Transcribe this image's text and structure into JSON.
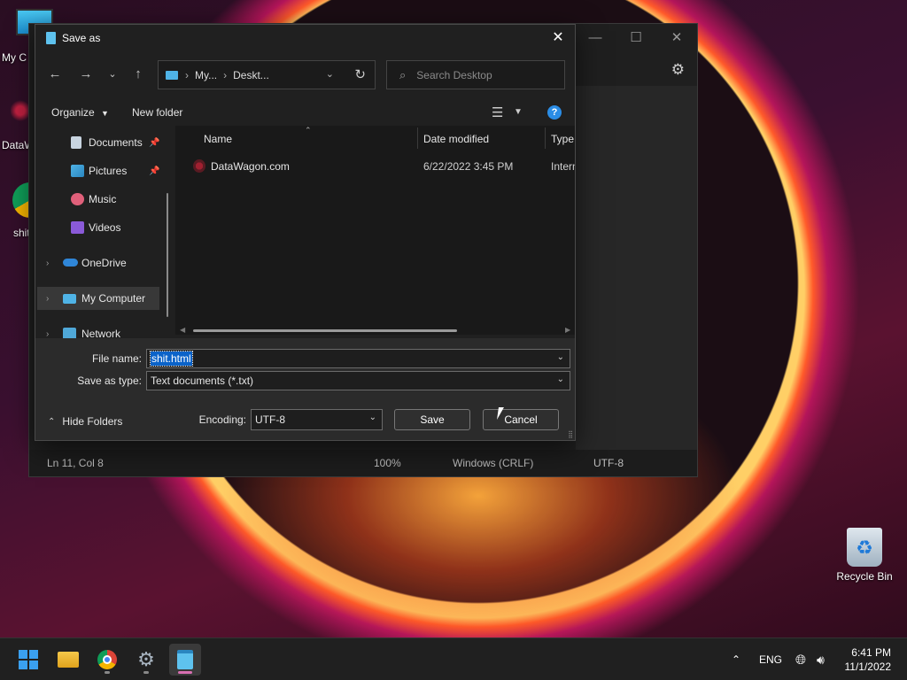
{
  "desktop": {
    "icons": [
      "My C",
      "DataW",
      "shit"
    ],
    "recycle_bin": "Recycle Bin"
  },
  "notepad": {
    "status": {
      "position": "Ln 11, Col 8",
      "zoom": "100%",
      "line_ending": "Windows (CRLF)",
      "encoding": "UTF-8"
    }
  },
  "dialog": {
    "title": "Save as",
    "address": {
      "segment1": "My...",
      "segment2": "Deskt..."
    },
    "search_placeholder": "Search Desktop",
    "toolbar": {
      "organize": "Organize",
      "new_folder": "New folder"
    },
    "nav_items": [
      {
        "label": "Documents"
      },
      {
        "label": "Pictures"
      },
      {
        "label": "Music"
      },
      {
        "label": "Videos"
      },
      {
        "label": "OneDrive"
      },
      {
        "label": "My Computer"
      },
      {
        "label": "Network"
      }
    ],
    "columns": {
      "name": "Name",
      "date": "Date modified",
      "type": "Type"
    },
    "files": [
      {
        "name": "DataWagon.com",
        "date": "6/22/2022 3:45 PM",
        "type": "Intern"
      }
    ],
    "file_name_label": "File name:",
    "file_name_value": "shit.html",
    "save_type_label": "Save as type:",
    "save_type_value": "Text documents (*.txt)",
    "hide_folders": "Hide Folders",
    "encoding_label": "Encoding:",
    "encoding_value": "UTF-8",
    "save_button": "Save",
    "cancel_button": "Cancel"
  },
  "taskbar": {
    "language": "ENG",
    "time": "6:41 PM",
    "date": "11/1/2022"
  },
  "colors": {
    "accent": "#0b63c9",
    "help_blue": "#2b8de6",
    "taskbar": "#202020"
  }
}
